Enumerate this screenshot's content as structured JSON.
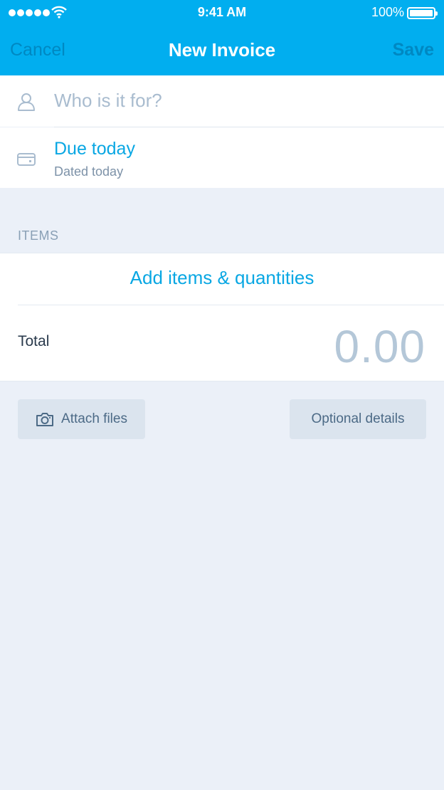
{
  "status_bar": {
    "time": "9:41 AM",
    "battery_percent": "100%",
    "signal_icon": "signal-dots-icon",
    "wifi_icon": "wifi-icon",
    "battery_icon": "battery-icon"
  },
  "nav": {
    "cancel_label": "Cancel",
    "title": "New Invoice",
    "save_label": "Save"
  },
  "client": {
    "icon": "person-icon",
    "placeholder": "Who is it for?"
  },
  "due": {
    "icon": "card-icon",
    "title": "Due today",
    "subtitle": "Dated today"
  },
  "items": {
    "header": "ITEMS",
    "add_label": "Add items & quantities",
    "total_label": "Total",
    "total_value": "0.00"
  },
  "actions": {
    "attach_label": "Attach files",
    "attach_icon": "camera-icon",
    "optional_label": "Optional details"
  },
  "colors": {
    "header_bg": "#01aeef",
    "accent": "#09a7e3",
    "background": "#ebf0f8"
  }
}
